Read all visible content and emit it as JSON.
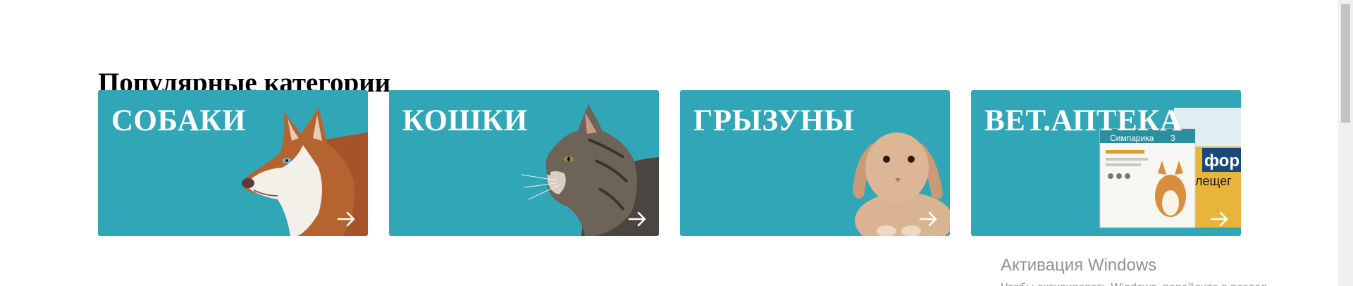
{
  "section": {
    "title": "Популярные категории"
  },
  "categories": [
    {
      "label": "СОБАКИ",
      "icon": "husky-dog-image",
      "arrow_icon": "arrow-right-icon"
    },
    {
      "label": "КОШКИ",
      "icon": "tabby-cat-image",
      "arrow_icon": "arrow-right-icon"
    },
    {
      "label": "ГРЫЗУНЫ",
      "icon": "rabbit-image",
      "arrow_icon": "arrow-right-icon"
    },
    {
      "label": "ВЕТ.АПТЕКА",
      "icon": "medicine-boxes-image",
      "arrow_icon": "arrow-right-icon"
    }
  ],
  "products": {
    "box1_brand": "Симпарика",
    "box1_count": "3",
    "box2_brand": "фор",
    "box2_sub": "лещег"
  },
  "watermark": {
    "title": "Активация Windows",
    "subtitle": "Чтобы активировать Windows, перейдите в раздел"
  },
  "colors": {
    "card_bg": "#31a6b7",
    "card_text": "#ffffff",
    "title_text": "#000000"
  }
}
